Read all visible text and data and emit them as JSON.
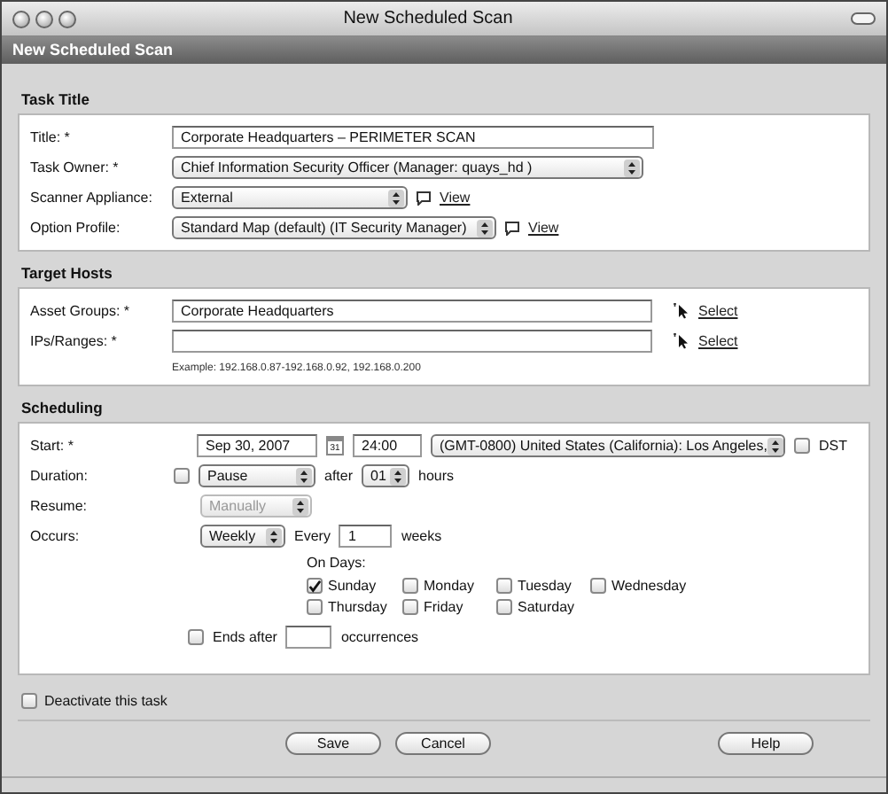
{
  "window": {
    "title": "New Scheduled Scan"
  },
  "header": {
    "title": "New Scheduled Scan"
  },
  "task_title": {
    "heading": "Task Title",
    "fields": [
      {
        "label": "Title: *",
        "kind": "text",
        "value": "Corporate Headquarters – PERIMETER SCAN"
      },
      {
        "label": "Task Owner: *",
        "kind": "select",
        "value": "Chief Information Security Officer (Manager: quays_hd )"
      },
      {
        "label": "Scanner Appliance:",
        "kind": "select",
        "value": "External",
        "link": "View"
      },
      {
        "label": "Option Profile:",
        "kind": "select",
        "value": "Standard Map (default) (IT Security Manager)",
        "link": "View"
      }
    ]
  },
  "target_hosts": {
    "heading": "Target Hosts",
    "fields": [
      {
        "label": "Asset Groups: *",
        "value": "Corporate Headquarters",
        "link": "Select"
      },
      {
        "label": "IPs/Ranges: *",
        "link": "Select"
      }
    ],
    "example": "Example: 192.168.0.87-192.168.0.92, 192.168.0.200"
  },
  "scheduling": {
    "heading": "Scheduling",
    "start": {
      "label": "Start: *",
      "date": "Sep 30, 2007",
      "calendar_day": "31",
      "time": "24:00",
      "timezone": "(GMT-0800) United States (California): Los Angeles,",
      "dst_label": "DST",
      "dst_checked": false
    },
    "duration": {
      "label": "Duration:",
      "checked": false,
      "action": "Pause",
      "after": "after",
      "hours": "01",
      "unit": "hours"
    },
    "resume": {
      "label": "Resume:",
      "value": "Manually",
      "disabled": true
    },
    "occurs": {
      "label": "Occurs:",
      "value": "Weekly",
      "every": "Every",
      "interval": "1",
      "unit": "weeks"
    },
    "days_label": "On Days:",
    "days": [
      {
        "label": "Sunday",
        "checked": true
      },
      {
        "label": "Monday",
        "checked": false
      },
      {
        "label": "Tuesday",
        "checked": false
      },
      {
        "label": "Wednesday",
        "checked": false
      },
      {
        "label": "Thursday",
        "checked": false
      },
      {
        "label": "Friday",
        "checked": false
      },
      {
        "label": "Saturday",
        "checked": false
      }
    ],
    "ends": {
      "checked": false,
      "label": "Ends after",
      "unit": "occurrences"
    }
  },
  "deactivate": {
    "label": "Deactivate this task",
    "checked": false
  },
  "buttons": [
    {
      "label": "Save",
      "kind": "primary"
    },
    {
      "label": "Cancel",
      "kind": "primary"
    },
    {
      "label": "Help",
      "kind": "help"
    }
  ]
}
